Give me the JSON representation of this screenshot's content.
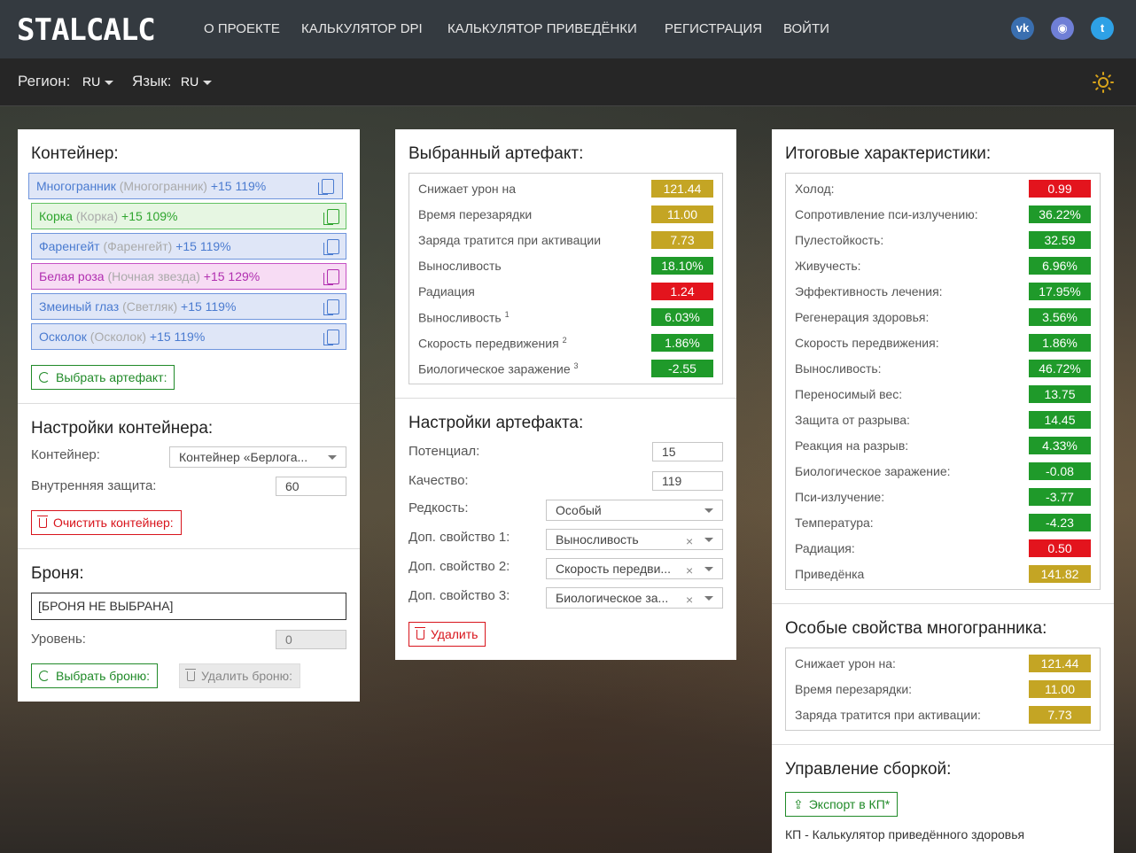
{
  "nav": {
    "logo": "STALCALC",
    "items": [
      "О ПРОЕКТЕ",
      "КАЛЬКУЛЯТОР DPI",
      "КАЛЬКУЛЯТОР ПРИВЕДЁНКИ",
      "РЕГИСТРАЦИЯ",
      "ВОЙТИ"
    ],
    "social": [
      {
        "name": "vk-icon",
        "glyph": "vk",
        "color": "#3a6fb0"
      },
      {
        "name": "discord-icon",
        "glyph": "◉",
        "color": "#6f7fd6"
      },
      {
        "name": "twitter-icon",
        "glyph": "t",
        "color": "#2ea1e6"
      }
    ]
  },
  "subbar": {
    "region_label": "Регион:",
    "region_value": "RU",
    "lang_label": "Язык:",
    "lang_value": "RU",
    "theme_icon": "sun-icon"
  },
  "container": {
    "title": "Контейнер:",
    "items": [
      {
        "name": "Многогранник",
        "alt": "(Многогранник)",
        "bonus": "+15 119%",
        "color": "#4a7bd0",
        "bg": "#dfe6f7",
        "border": "#6f95dd"
      },
      {
        "name": "Корка",
        "alt": "(Корка)",
        "bonus": "+15 109%",
        "color": "#2ea52e",
        "bg": "#e6f6e2",
        "border": "#62c262"
      },
      {
        "name": "Фаренгейт",
        "alt": "(Фаренгейт)",
        "bonus": "+15 119%",
        "color": "#4a7bd0",
        "bg": "#dfe6f7",
        "border": "#6f95dd"
      },
      {
        "name": "Белая роза",
        "alt": "(Ночная звезда)",
        "bonus": "+15 129%",
        "color": "#b12fb0",
        "bg": "#f7dcf4",
        "border": "#c552c4"
      },
      {
        "name": "Змеиный глаз",
        "alt": "(Светляк)",
        "bonus": "+15 119%",
        "color": "#4a7bd0",
        "bg": "#dfe6f7",
        "border": "#6f95dd"
      },
      {
        "name": "Осколок",
        "alt": "(Осколок)",
        "bonus": "+15 119%",
        "color": "#4a7bd0",
        "bg": "#dfe6f7",
        "border": "#6f95dd"
      }
    ],
    "select_artifact": "Выбрать артефакт:"
  },
  "container_settings": {
    "title": "Настройки контейнера:",
    "container_label": "Контейнер:",
    "container_value": "Контейнер «Берлога...",
    "inner_protection_label": "Внутренняя защита:",
    "inner_protection_value": "60",
    "clear_button": "Очистить контейнер:"
  },
  "armor": {
    "title": "Броня:",
    "value": "[БРОНЯ НЕ ВЫБРАНА]",
    "level_label": "Уровень:",
    "level_value": "0",
    "select_button": "Выбрать броню:",
    "delete_button": "Удалить броню:"
  },
  "artifact": {
    "title": "Выбранный артефакт:",
    "stats": [
      {
        "label": "Снижает урон на",
        "sup": "",
        "value": "121.44",
        "color": "gold"
      },
      {
        "label": "Время перезарядки",
        "sup": "",
        "value": "11.00",
        "color": "gold"
      },
      {
        "label": "Заряда тратится при активации",
        "sup": "",
        "value": "7.73",
        "color": "gold"
      },
      {
        "label": "Выносливость",
        "sup": "",
        "value": "18.10%",
        "color": "green"
      },
      {
        "label": "Радиация",
        "sup": "",
        "value": "1.24",
        "color": "red"
      },
      {
        "label": "Выносливость",
        "sup": "1",
        "value": "6.03%",
        "color": "green"
      },
      {
        "label": "Скорость передвижения",
        "sup": "2",
        "value": "1.86%",
        "color": "green"
      },
      {
        "label": "Биологическое заражение",
        "sup": "3",
        "value": "-2.55",
        "color": "green"
      }
    ]
  },
  "artifact_settings": {
    "title": "Настройки артефакта:",
    "potential_label": "Потенциал:",
    "potential_value": "15",
    "quality_label": "Качество:",
    "quality_value": "119",
    "rarity_label": "Редкость:",
    "rarity_value": "Особый",
    "prop1_label": "Доп. свойство 1:",
    "prop1_value": "Выносливость",
    "prop2_label": "Доп. свойство 2:",
    "prop2_value": "Скорость передви...",
    "prop3_label": "Доп. свойство 3:",
    "prop3_value": "Биологическое за...",
    "delete_button": "Удалить"
  },
  "totals": {
    "title": "Итоговые характеристики:",
    "stats": [
      {
        "label": "Холод:",
        "value": "0.99",
        "color": "red"
      },
      {
        "label": "Сопротивление пси-излучению:",
        "value": "36.22%",
        "color": "green"
      },
      {
        "label": "Пулестойкость:",
        "value": "32.59",
        "color": "green"
      },
      {
        "label": "Живучесть:",
        "value": "6.96%",
        "color": "green"
      },
      {
        "label": "Эффективность лечения:",
        "value": "17.95%",
        "color": "green"
      },
      {
        "label": "Регенерация здоровья:",
        "value": "3.56%",
        "color": "green"
      },
      {
        "label": "Скорость передвижения:",
        "value": "1.86%",
        "color": "green"
      },
      {
        "label": "Выносливость:",
        "value": "46.72%",
        "color": "green"
      },
      {
        "label": "Переносимый вес:",
        "value": "13.75",
        "color": "green"
      },
      {
        "label": "Защита от разрыва:",
        "value": "14.45",
        "color": "green"
      },
      {
        "label": "Реакция на разрыв:",
        "value": "4.33%",
        "color": "green"
      },
      {
        "label": "Биологическое заражение:",
        "value": "-0.08",
        "color": "green"
      },
      {
        "label": "Пси-излучение:",
        "value": "-3.77",
        "color": "green"
      },
      {
        "label": "Температура:",
        "value": "-4.23",
        "color": "green"
      },
      {
        "label": "Радиация:",
        "value": "0.50",
        "color": "red"
      },
      {
        "label": "Приведёнка",
        "value": "141.82",
        "color": "gold"
      }
    ]
  },
  "special": {
    "title": "Особые свойства многогранника:",
    "stats": [
      {
        "label": "Снижает урон на:",
        "value": "121.44",
        "color": "gold"
      },
      {
        "label": "Время перезарядки:",
        "value": "11.00",
        "color": "gold"
      },
      {
        "label": "Заряда тратится при активации:",
        "value": "7.73",
        "color": "gold"
      }
    ]
  },
  "build": {
    "title": "Управление сборкой:",
    "export_button": "Экспорт в КП*",
    "note": "КП - Калькулятор приведённого здоровья"
  }
}
